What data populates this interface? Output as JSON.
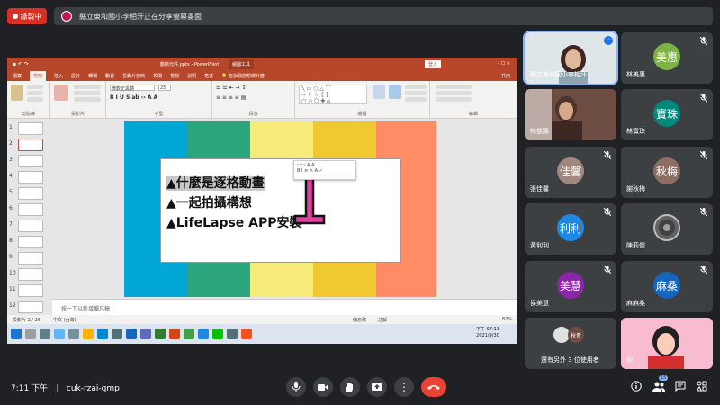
{
  "recording": {
    "label": "錄製中"
  },
  "presenting_banner": {
    "text": "縣立東和國小李相汗正在分享螢幕畫面"
  },
  "powerpoint": {
    "title": "動態元件.pptx  -  PowerPoint",
    "context_tab": "繪圖工具",
    "login": "登入",
    "share": "共用",
    "tabs": [
      "檔案",
      "常用",
      "插入",
      "設計",
      "轉場",
      "動畫",
      "投影片放映",
      "校閱",
      "檢視",
      "說明",
      "格式"
    ],
    "tell_me": "告訴我您想做什麼",
    "ribbon_groups": [
      "剪貼簿",
      "投影片",
      "字型",
      "段落",
      "繪圖",
      "編輯"
    ],
    "font_name": "微軟正黑體",
    "font_size": "25",
    "slide_numbers": [
      "1",
      "2",
      "3",
      "4",
      "5",
      "6",
      "7",
      "8",
      "9",
      "10",
      "11",
      "12"
    ],
    "slide_bullets": [
      "▲什麼是逐格動畫",
      "▲一起拍攝構想",
      "▲LifeLapse APP安裝"
    ],
    "stripe_colors": [
      "#00a6d6",
      "#2aa57e",
      "#f5ea7a",
      "#f0c930",
      "#ff8c64"
    ],
    "notes_placeholder": "按一下以新增備忘稿",
    "status_slide": "投影片 2 / 26",
    "status_lang": "中文 (台灣)",
    "status_notes": "備忘稿",
    "status_comments": "註解",
    "zoom": "82%",
    "clock_time": "下午 07:11",
    "clock_date": "2021/9/30"
  },
  "participants": [
    {
      "name": "縣立東和國小李相汗",
      "type": "video",
      "bg": "#cfd8dc",
      "pinned": true
    },
    {
      "name": "林美惠",
      "avatar": "美惠",
      "color": "#7cb342"
    },
    {
      "name": "林慈陽",
      "type": "video",
      "bg": "#8d6e63"
    },
    {
      "name": "林寶珠",
      "avatar": "寶珠",
      "color": "#00897b"
    },
    {
      "name": "張佳馨",
      "avatar": "佳馨",
      "color": "#a1887f"
    },
    {
      "name": "謝秋梅",
      "avatar": "秋梅",
      "color": "#8d6e63"
    },
    {
      "name": "黃利利",
      "avatar": "利利",
      "color": "#1e88e5"
    },
    {
      "name": "陳莉儒",
      "type": "video",
      "bg": "#616161"
    },
    {
      "name": "侯美慧",
      "avatar": "美慧",
      "color": "#8e24aa"
    },
    {
      "name": "麻麻桑",
      "avatar": "麻桑",
      "color": "#1565c0"
    }
  ],
  "others_tile": {
    "text": "還有另外 3 位使用者",
    "avatar": "秋貴"
  },
  "self_tile": {
    "name": "你"
  },
  "footer": {
    "time": "7:11 下午",
    "separator": "|",
    "meeting_code": "cuk-rzai-gmp",
    "people_count": "15"
  }
}
